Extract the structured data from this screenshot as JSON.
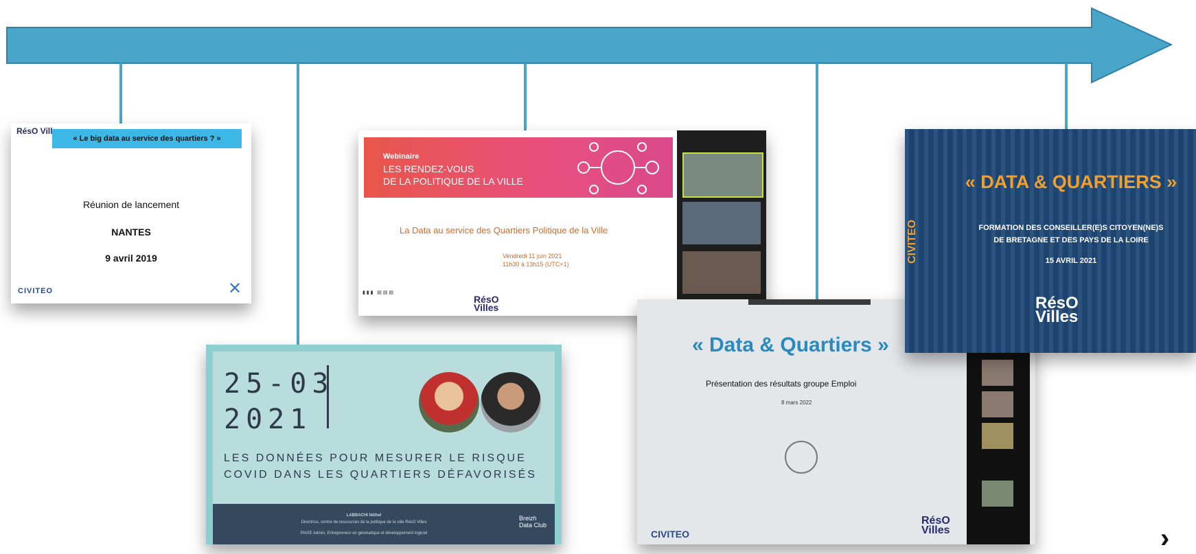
{
  "timeline": {
    "arrow_color": "#4aa6c9"
  },
  "card1": {
    "logo": "RésO Villes",
    "banner": "« Le big data au service des quartiers ? »",
    "line1": "Réunion de lancement",
    "line2": "NANTES",
    "line3": "9 avril 2019",
    "civiteo": "CIVITEO"
  },
  "card2": {
    "date_line1": "25-03",
    "date_line2": "2021",
    "title": "LES DONNÉES POUR MESURER LE RISQUE COVID DANS LES QUARTIERS DÉFAVORISÉS",
    "footer_name1": "LABBACHI Ibtihel",
    "footer_role1": "Directrice, centre de ressources de la politique de la ville RésO Villes",
    "footer_name2": "PAVIE Adrien, Entrepreneur en géomatique et développement logiciel",
    "club": "Breizh Data Club"
  },
  "card3": {
    "webinaire": "Webinaire",
    "header_line1": "LES RENDEZ-VOUS",
    "header_line2": "DE LA POLITIQUE DE LA VILLE",
    "subtitle": "La Data au service des Quartiers Politique de la Ville",
    "date_line1": "Vendredi 11 juin 2021",
    "date_line2": "11h30 à 13h15 (UTC+1)",
    "reso": "RésO Villes"
  },
  "card4": {
    "title": "« Data & Quartiers »",
    "subtitle": "Présentation des résultats groupe Emploi",
    "date": "8 mars 2022",
    "civiteo": "CIVITEO",
    "reso": "RésO Villes"
  },
  "card5": {
    "title": "« DATA & QUARTIERS »",
    "sub1": "FORMATION DES CONSEILLER(E)S CITOYEN(NE)S",
    "sub2": "DE BRETAGNE ET DES PAYS DE LA LOIRE",
    "date": "15 AVRIL 2021",
    "reso": "RésO Villes",
    "civiteo": "CIVITEO"
  },
  "next_icon": "chevron-right-icon"
}
